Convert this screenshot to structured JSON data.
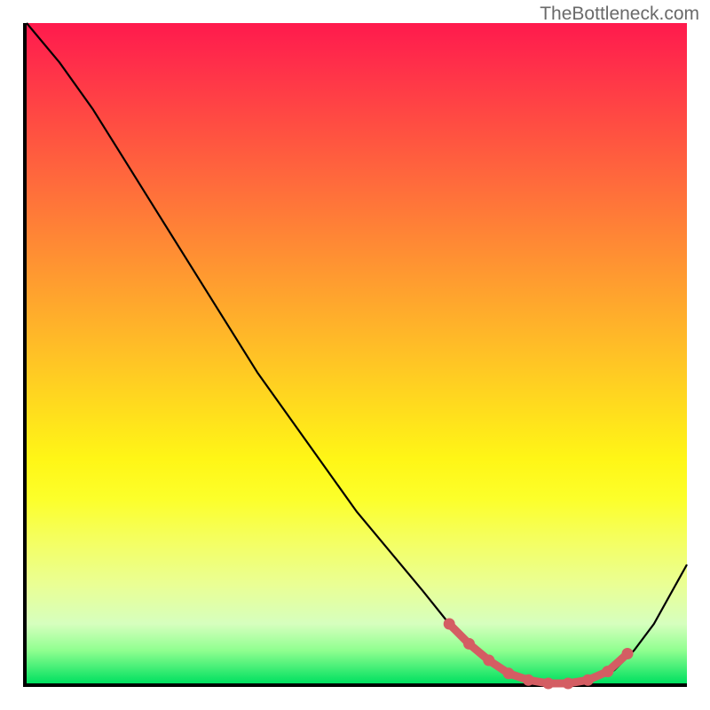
{
  "watermark": "TheBottleneck.com",
  "chart_data": {
    "type": "line",
    "title": "",
    "xlabel": "",
    "ylabel": "",
    "xlim": [
      0,
      100
    ],
    "ylim": [
      0,
      100
    ],
    "series": [
      {
        "name": "curve",
        "x": [
          0,
          5,
          10,
          15,
          20,
          25,
          30,
          35,
          40,
          45,
          50,
          55,
          60,
          64,
          68,
          72,
          75,
          78,
          82,
          86,
          89,
          92,
          95,
          100
        ],
        "y": [
          100,
          94,
          87,
          79,
          71,
          63,
          55,
          47,
          40,
          33,
          26,
          20,
          14,
          9,
          5,
          2,
          0.5,
          0,
          0,
          0.5,
          2,
          5,
          9,
          18
        ]
      },
      {
        "name": "highlight-dots",
        "x": [
          64,
          67,
          70,
          73,
          76,
          79,
          82,
          85,
          88,
          91
        ],
        "y": [
          9,
          6,
          3.5,
          1.5,
          0.5,
          0,
          0,
          0.5,
          1.8,
          4.5
        ]
      }
    ],
    "colors": {
      "curve": "#000000",
      "highlight": "#d45d63"
    }
  }
}
